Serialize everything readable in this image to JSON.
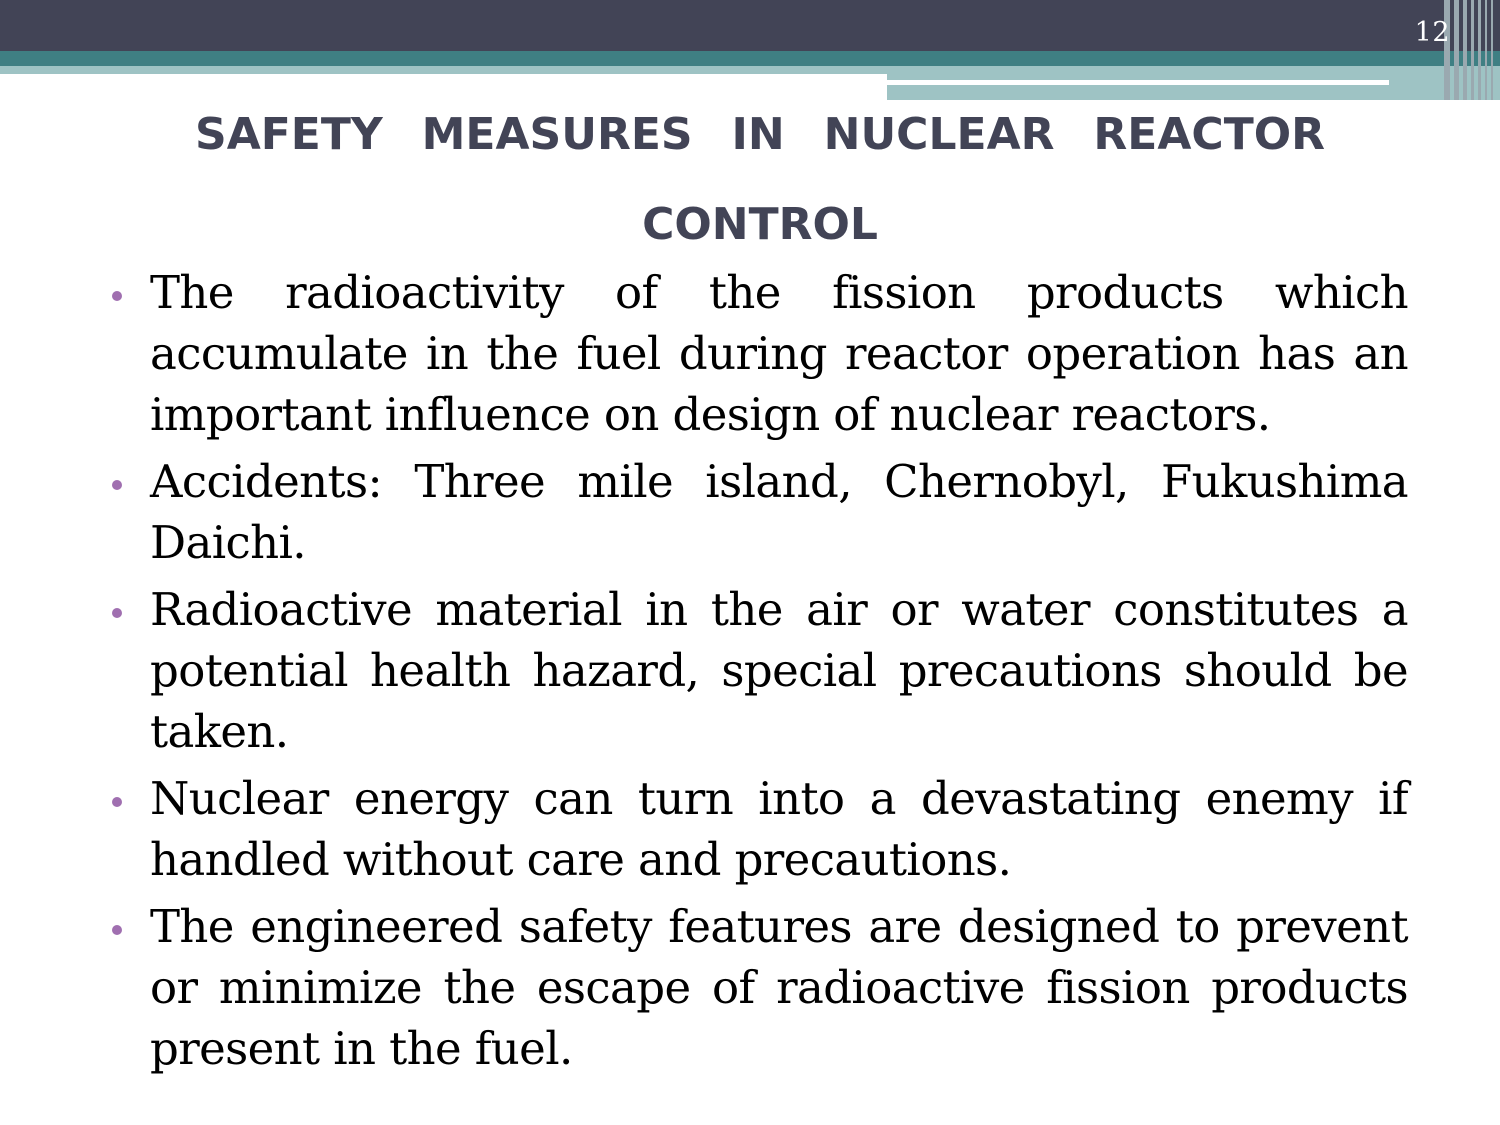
{
  "slide": {
    "page_number": "12",
    "title": "SAFETY MEASURES IN NUCLEAR REACTOR CONTROL",
    "bullets": [
      "The radioactivity of the fission products which accumulate in the fuel during reactor operation has an important influence on design of nuclear reactors.",
      "Accidents: Three mile island, Chernobyl, Fukushima Daichi.",
      "Radioactive material in the air or water constitutes a potential health hazard, special precautions should be taken.",
      "Nuclear energy can turn into a devastating enemy if handled without care and precautions.",
      "The engineered safety features are designed to prevent or minimize the escape of radioactive fission products present in the fuel."
    ]
  },
  "colors": {
    "header_dark": "#424456",
    "header_teal": "#3f7f83",
    "header_light": "#9ec3c4",
    "title_text": "#424456",
    "bullet_marker": "#a06fb0",
    "body_text": "#000000"
  }
}
